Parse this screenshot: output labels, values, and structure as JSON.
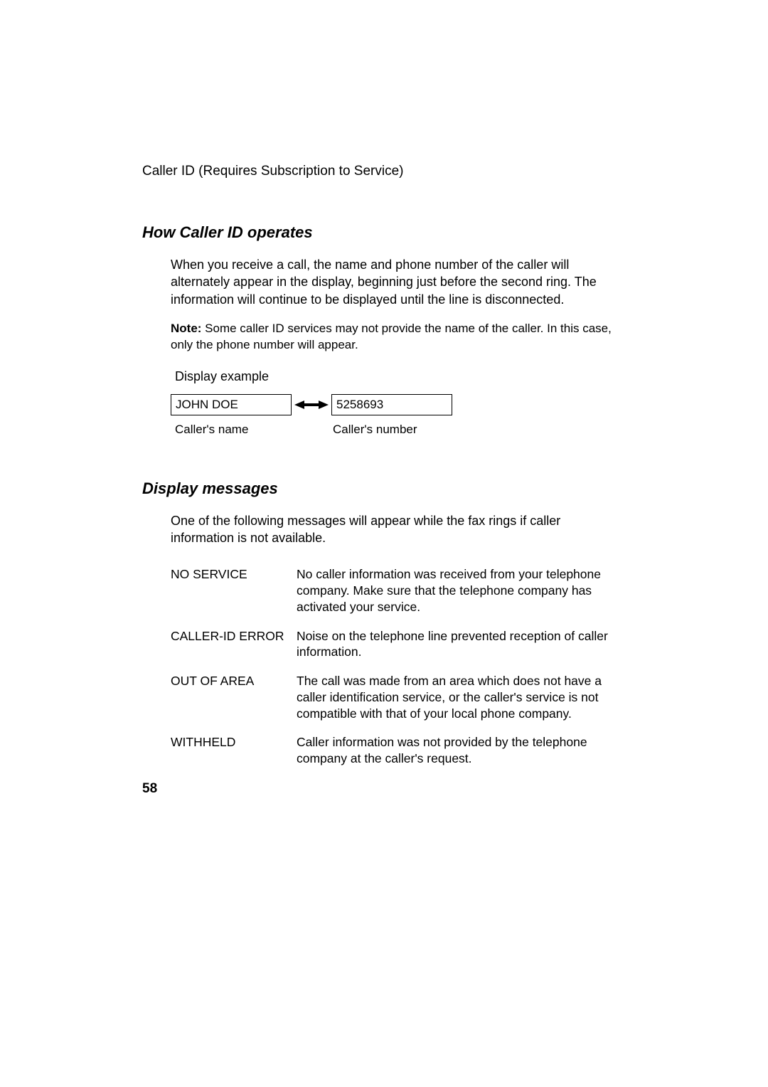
{
  "header": "Caller ID (Requires Subscription to Service)",
  "section1": {
    "heading": "How Caller ID operates",
    "para": "When you receive a call, the name and phone number of the caller will alternately appear in the display, beginning just before the second ring. The information will continue to be displayed until the line is disconnected.",
    "note_label": "Note:",
    "note_text": " Some caller ID services may not provide the name of the caller. In this case, only the phone number will appear.",
    "display_example_label": "Display example",
    "box_left": "JOHN DOE",
    "box_right": "5258693",
    "caption_left": "Caller's name",
    "caption_right": "Caller's number"
  },
  "section2": {
    "heading": "Display messages",
    "intro": "One of the following messages will appear while the fax rings if caller information is not available.",
    "messages": [
      {
        "term": "NO SERVICE",
        "desc": "No caller information was received from your telephone company. Make sure that the telephone company has activated your service."
      },
      {
        "term": "CALLER-ID ERROR",
        "desc": "Noise on the telephone line prevented reception of caller information."
      },
      {
        "term": "OUT OF AREA",
        "desc": "The call was made from an area which does not have a caller identification service, or the caller's service is not compatible with that of your local phone company."
      },
      {
        "term": "WITHHELD",
        "desc": "Caller information was not provided by the telephone company at the caller's request."
      }
    ]
  },
  "page_number": "58"
}
